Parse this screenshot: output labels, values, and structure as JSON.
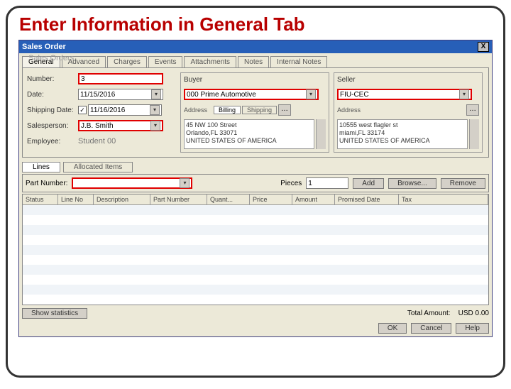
{
  "slide": {
    "title": "Enter Information in General Tab"
  },
  "bg_window_title": "Sales Orders",
  "window": {
    "title": "Sales Order"
  },
  "tabs": [
    "General",
    "Advanced",
    "Charges",
    "Events",
    "Attachments",
    "Notes",
    "Internal Notes"
  ],
  "left": {
    "number_label": "Number:",
    "number_value": "3",
    "date_label": "Date:",
    "date_value": "11/15/2016",
    "ship_label": "Shipping Date:",
    "ship_checked": "✓",
    "ship_value": "11/16/2016",
    "sales_label": "Salesperson:",
    "sales_value": "J.B. Smith",
    "emp_label": "Employee:",
    "emp_value": "Student 00"
  },
  "buyer": {
    "title": "Buyer",
    "value": "000 Prime Automotive",
    "addr_label": "Address",
    "minitabs": [
      "Billing",
      "Shipping"
    ],
    "addr1": "45 NW 100 Street",
    "addr2": "Orlando,FL 33071",
    "addr3": "UNITED STATES OF AMERICA"
  },
  "seller": {
    "title": "Seller",
    "value": "FIU-CEC",
    "addr_label": "Address",
    "addr1": "10555 west flagler st",
    "addr2": "miami,FL 33174",
    "addr3": "UNITED STATES OF AMERICA"
  },
  "subtabs": [
    "Lines",
    "Allocated Items"
  ],
  "linebar": {
    "part_label": "Part Number:",
    "pieces_label": "Pieces",
    "pieces_value": "1",
    "add": "Add",
    "browse": "Browse...",
    "remove": "Remove"
  },
  "grid_headers": [
    "Status",
    "Line No",
    "Description",
    "Part Number",
    "Quant...",
    "Price",
    "Amount",
    "Promised Date",
    "Tax"
  ],
  "footer": {
    "show_stats": "Show statistics",
    "total_label": "Total Amount:",
    "total_value": "USD 0.00"
  },
  "buttons": {
    "ok": "OK",
    "cancel": "Cancel",
    "help": "Help"
  }
}
